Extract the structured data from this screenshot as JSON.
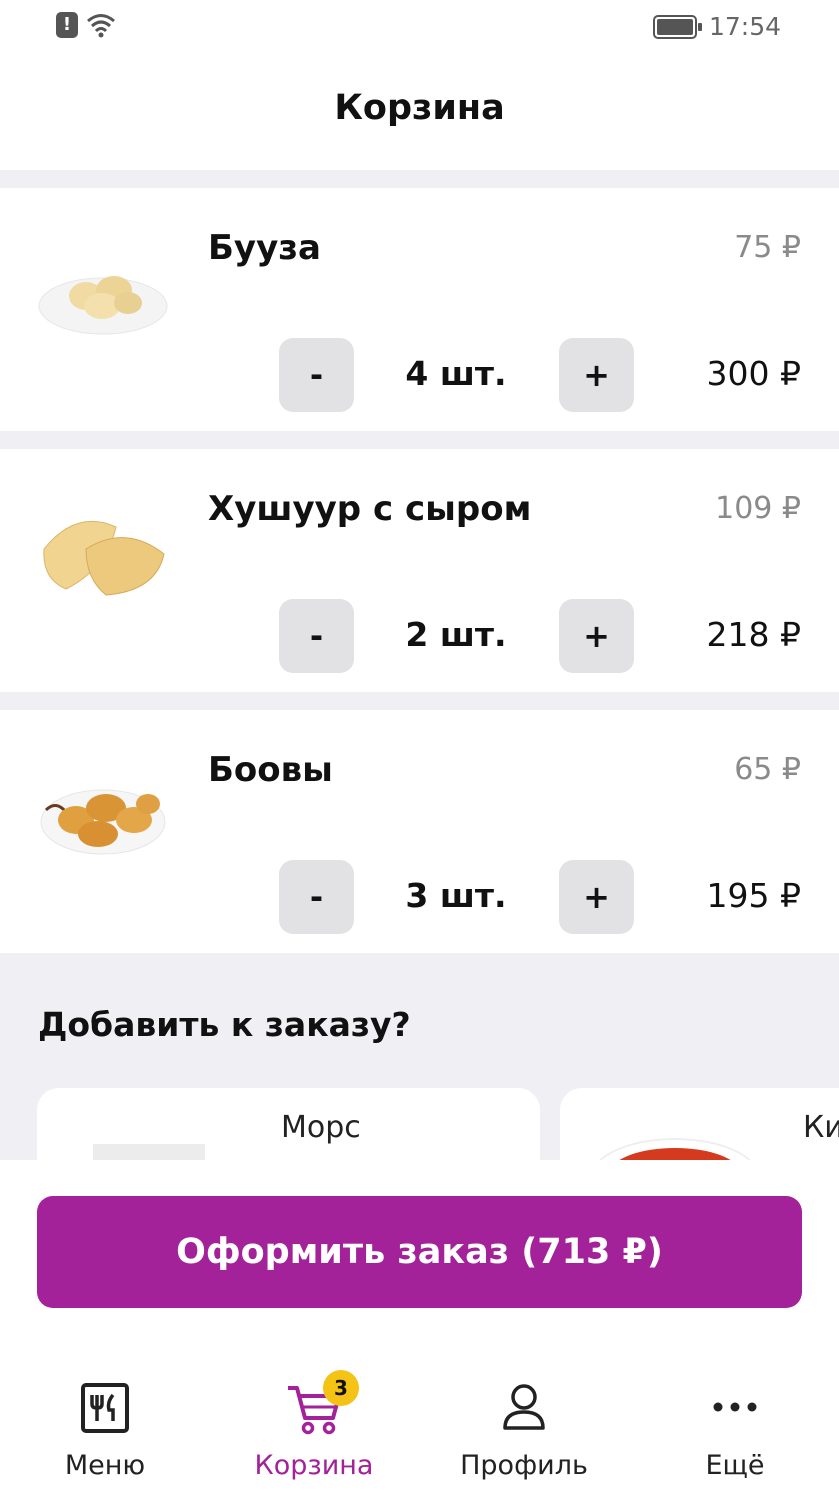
{
  "status_bar": {
    "time": "17:54",
    "alert_glyph": "!"
  },
  "header": {
    "title": "Корзина"
  },
  "cart": {
    "items": [
      {
        "name": "Бууза",
        "unit_price": "75 ₽",
        "quantity": "4 шт.",
        "total": "300 ₽",
        "minus_label": "-",
        "plus_label": "+"
      },
      {
        "name": "Хушуур с сыром",
        "unit_price": "109 ₽",
        "quantity": "2 шт.",
        "total": "218 ₽",
        "minus_label": "-",
        "plus_label": "+"
      },
      {
        "name": "Боовы",
        "unit_price": "65 ₽",
        "quantity": "3 шт.",
        "total": "195 ₽",
        "minus_label": "-",
        "plus_label": "+"
      }
    ]
  },
  "addons": {
    "title": "Добавить к заказу?",
    "cards": [
      {
        "name": "Морс"
      },
      {
        "name": "Ки"
      }
    ]
  },
  "checkout": {
    "label": "Оформить заказ (713 ₽)"
  },
  "tabbar": {
    "items": [
      {
        "label": "Меню",
        "icon": "menu-icon"
      },
      {
        "label": "Корзина",
        "icon": "cart-icon",
        "badge": "3"
      },
      {
        "label": "Профиль",
        "icon": "profile-icon"
      },
      {
        "label": "Ещё",
        "icon": "more-icon"
      }
    ]
  },
  "colors": {
    "accent": "#a3229a",
    "badge": "#f4c315",
    "background": "#efeff4",
    "button": "#e2e2e4"
  }
}
